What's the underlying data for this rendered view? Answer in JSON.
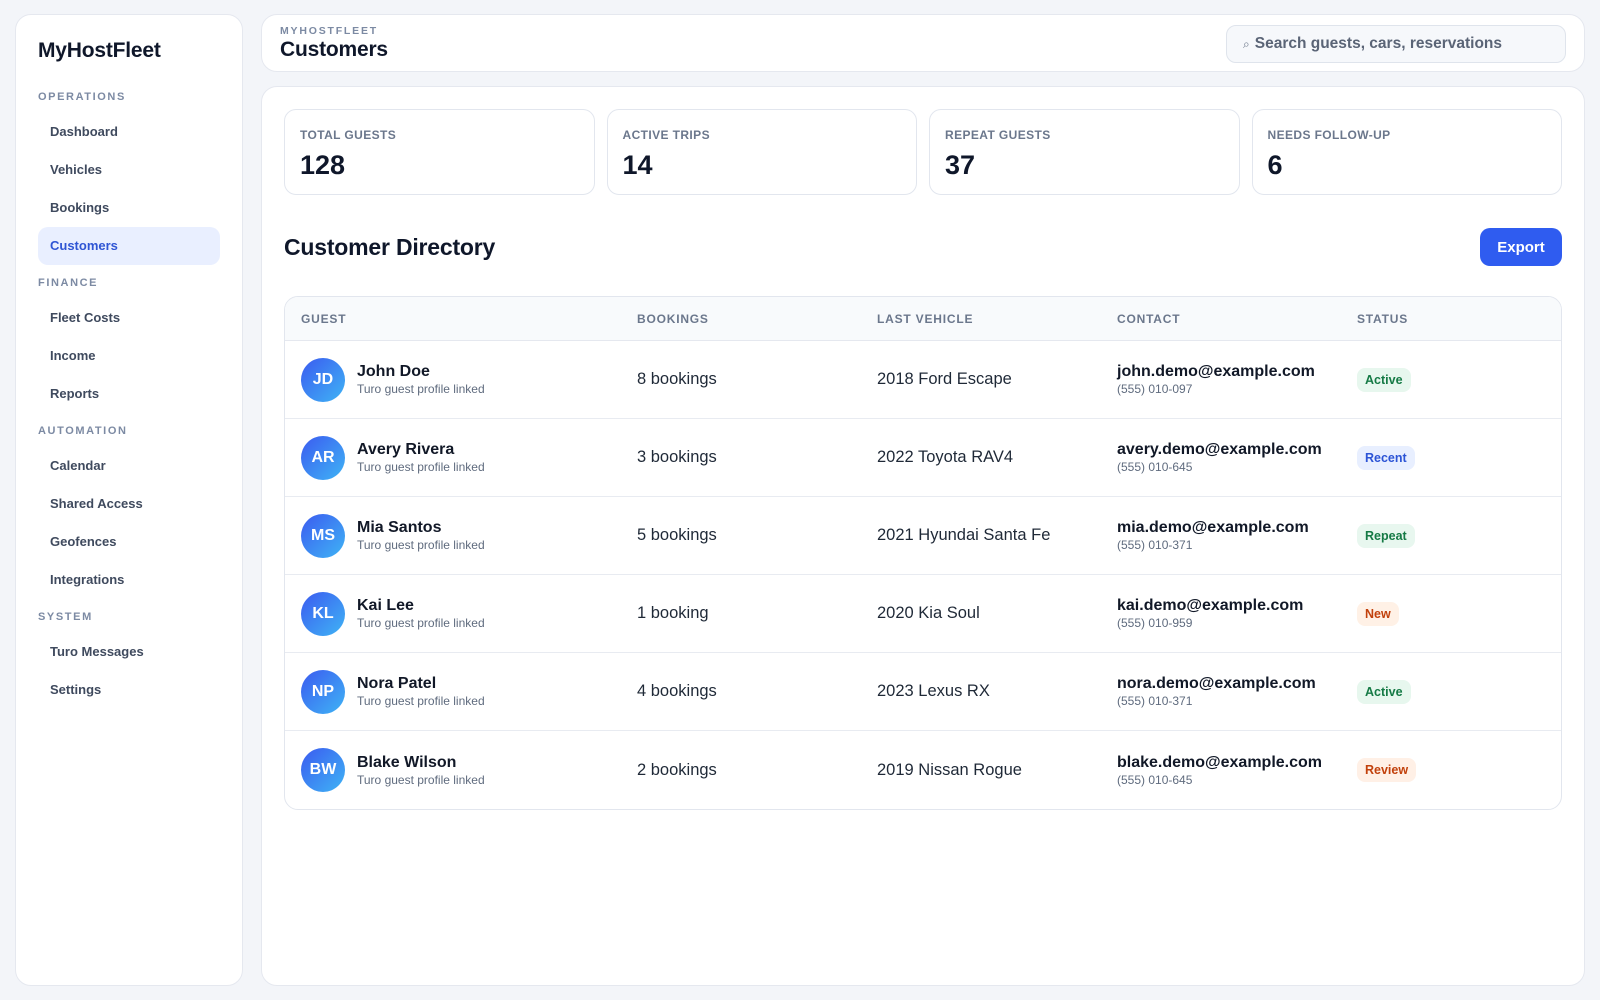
{
  "app": {
    "brand": "MyHostFleet"
  },
  "sidebar": {
    "sections": [
      {
        "title": "OPERATIONS",
        "items": [
          "Dashboard",
          "Vehicles",
          "Bookings",
          "Customers"
        ]
      },
      {
        "title": "FINANCE",
        "items": [
          "Fleet Costs",
          "Income",
          "Reports"
        ]
      },
      {
        "title": "AUTOMATION",
        "items": [
          "Calendar",
          "Shared Access",
          "Geofences",
          "Integrations"
        ]
      },
      {
        "title": "SYSTEM",
        "items": [
          "Turo Messages",
          "Settings"
        ]
      }
    ],
    "active_item": "Customers"
  },
  "header": {
    "breadcrumb": "MYHOSTFLEET",
    "title": "Customers",
    "search_placeholder": "Search guests, cars, reservations",
    "search_icon": "search-icon"
  },
  "stats": [
    {
      "label": "TOTAL GUESTS",
      "value": "128"
    },
    {
      "label": "ACTIVE TRIPS",
      "value": "14"
    },
    {
      "label": "REPEAT GUESTS",
      "value": "37"
    },
    {
      "label": "NEEDS FOLLOW-UP",
      "value": "6"
    }
  ],
  "directory": {
    "title": "Customer Directory",
    "export_label": "Export",
    "columns": [
      "GUEST",
      "BOOKINGS",
      "LAST VEHICLE",
      "CONTACT",
      "STATUS"
    ],
    "rows": [
      {
        "initials": "JD",
        "name": "John Doe",
        "sub": "Turo guest profile linked",
        "bookings": "8 bookings",
        "vehicle": "2018 Ford Escape",
        "email": "john.demo@example.com",
        "phone": "(555) 010-097",
        "status": "Active",
        "status_class": "b-active"
      },
      {
        "initials": "AR",
        "name": "Avery Rivera",
        "sub": "Turo guest profile linked",
        "bookings": "3 bookings",
        "vehicle": "2022 Toyota RAV4",
        "email": "avery.demo@example.com",
        "phone": "(555) 010-645",
        "status": "Recent",
        "status_class": "b-recent"
      },
      {
        "initials": "MS",
        "name": "Mia Santos",
        "sub": "Turo guest profile linked",
        "bookings": "5 bookings",
        "vehicle": "2021 Hyundai Santa Fe",
        "email": "mia.demo@example.com",
        "phone": "(555) 010-371",
        "status": "Repeat",
        "status_class": "b-repeat"
      },
      {
        "initials": "KL",
        "name": "Kai Lee",
        "sub": "Turo guest profile linked",
        "bookings": "1 booking",
        "vehicle": "2020 Kia Soul",
        "email": "kai.demo@example.com",
        "phone": "(555) 010-959",
        "status": "New",
        "status_class": "b-new"
      },
      {
        "initials": "NP",
        "name": "Nora Patel",
        "sub": "Turo guest profile linked",
        "bookings": "4 bookings",
        "vehicle": "2023 Lexus RX",
        "email": "nora.demo@example.com",
        "phone": "(555) 010-371",
        "status": "Active",
        "status_class": "b-active"
      },
      {
        "initials": "BW",
        "name": "Blake Wilson",
        "sub": "Turo guest profile linked",
        "bookings": "2 bookings",
        "vehicle": "2019 Nissan Rogue",
        "email": "blake.demo@example.com",
        "phone": "(555) 010-645",
        "status": "Review",
        "status_class": "b-review"
      }
    ]
  },
  "colors": {
    "accent": "#2f5cf0",
    "active_nav_bg": "#e9efff",
    "active_nav_text": "#2f55d4"
  }
}
